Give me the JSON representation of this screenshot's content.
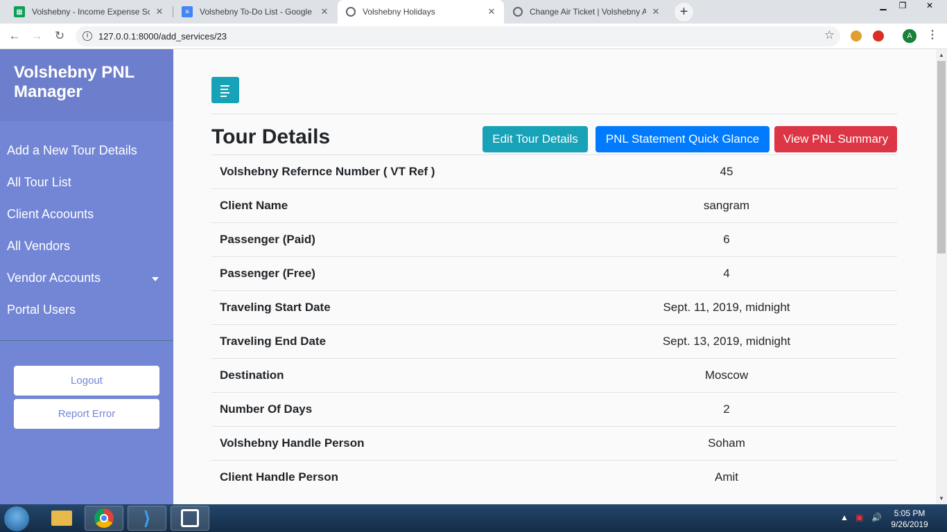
{
  "browser": {
    "tabs": [
      {
        "title": "Volshebny - Income Expense Sof",
        "icon": "google-sheets-icon",
        "color": "#0f9d58"
      },
      {
        "title": "Volshebny To-Do List - Google D",
        "icon": "google-docs-icon",
        "color": "#4285f4"
      },
      {
        "title": "Volshebny Holidays",
        "icon": "globe-icon",
        "color": "#5f6368"
      },
      {
        "title": "Change Air Ticket | Volshebny Ad",
        "icon": "globe-icon",
        "color": "#5f6368"
      }
    ],
    "url": "127.0.0.1:8000/add_services/23",
    "profile_initial": "A"
  },
  "sidebar": {
    "title": "Volshebny PNL Manager",
    "items": [
      {
        "label": "Add a New Tour Details"
      },
      {
        "label": "All Tour List"
      },
      {
        "label": "Client Acoounts"
      },
      {
        "label": "All Vendors"
      },
      {
        "label": "Vendor Accounts",
        "has_dropdown": true
      },
      {
        "label": "Portal Users"
      }
    ],
    "buttons": {
      "logout": "Logout",
      "report": "Report Error"
    }
  },
  "main": {
    "heading": "Tour Details",
    "actions": {
      "edit": "Edit Tour Details",
      "pnl_quick": "PNL Statement Quick Glance",
      "pnl_summary": "View PNL Summary"
    },
    "rows": [
      {
        "label": "Volshebny Refernce Number ( VT Ref )",
        "value": "45"
      },
      {
        "label": "Client Name",
        "value": "sangram"
      },
      {
        "label": "Passenger (Paid)",
        "value": "6"
      },
      {
        "label": "Passenger (Free)",
        "value": "4"
      },
      {
        "label": "Traveling Start Date",
        "value": "Sept. 11, 2019, midnight"
      },
      {
        "label": "Traveling End Date",
        "value": "Sept. 13, 2019, midnight"
      },
      {
        "label": "Destination",
        "value": "Moscow"
      },
      {
        "label": "Number Of Days",
        "value": "2"
      },
      {
        "label": "Volshebny Handle Person",
        "value": "Soham"
      },
      {
        "label": "Client Handle Person",
        "value": "Amit"
      }
    ]
  },
  "taskbar": {
    "time": "5:05 PM",
    "date": "9/26/2019"
  },
  "colors": {
    "sidebar": "#7386d5",
    "brand": "#6d7fcc",
    "info": "#17a2b8",
    "primary": "#007bff",
    "danger": "#dc3545"
  }
}
